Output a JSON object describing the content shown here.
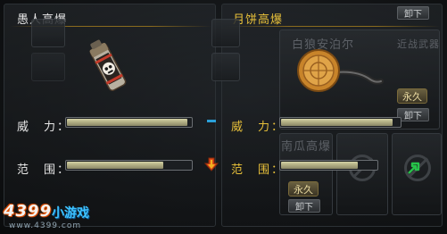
{
  "left_weapon": {
    "name": "愚人高爆",
    "power_label": "威　力：",
    "range_label": "范　围：",
    "power_fill": 0.97,
    "range_fill": 0.78
  },
  "right_weapon": {
    "name": "月饼高爆",
    "power_label": "威　力：",
    "range_label": "范　围：",
    "power_fill": 0.94,
    "range_fill": 0.8
  },
  "compare": {
    "power_indicator": "minus-dash",
    "range_indicator": "down-arrow",
    "power_color": "#2aa0d8",
    "range_color": "#e04a1a"
  },
  "background_cards": {
    "unload_top": "卸下",
    "item_name": "白狼安泊尔",
    "category": "近战武器",
    "permanent_1": "永久",
    "unload_mid": "卸下",
    "item_name_2": "南瓜高爆",
    "permanent_2": "永久",
    "unload_bottom": "卸下",
    "upgrade_color": "#27c24a"
  },
  "logo": {
    "number": "4399",
    "cn": "小游戏",
    "url": "www.4399.com"
  }
}
